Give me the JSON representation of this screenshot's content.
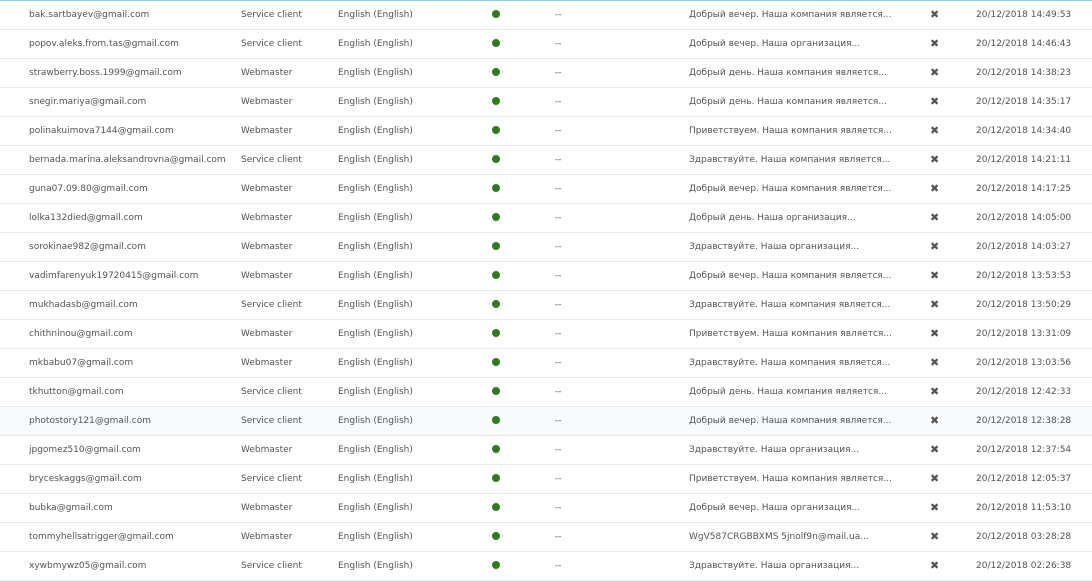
{
  "colors": {
    "status_online": "#2f7a1f",
    "row_border": "#e7eaec",
    "top_border": "#8fd0e6"
  },
  "icons": {
    "status": "status-dot-icon",
    "delete": "close-icon"
  },
  "rows": [
    {
      "email": "bak.sartbayev@gmail.com",
      "role": "Service client",
      "language": "English (English)",
      "dash": "--",
      "message": "Добрый вечер. Наша компания является...",
      "date": "20/12/2018 14:49:53"
    },
    {
      "email": "popov.aleks.from.tas@gmail.com",
      "role": "Service client",
      "language": "English (English)",
      "dash": "--",
      "message": "Добрый вечер. Наша организация...",
      "date": "20/12/2018 14:46:43"
    },
    {
      "email": "strawberry.boss.1999@gmail.com",
      "role": "Webmaster",
      "language": "English (English)",
      "dash": "--",
      "message": "Добрый день. Наша компания является...",
      "date": "20/12/2018 14:38:23"
    },
    {
      "email": "snegir.mariya@gmail.com",
      "role": "Webmaster",
      "language": "English (English)",
      "dash": "--",
      "message": "Добрый день. Наша компания является...",
      "date": "20/12/2018 14:35:17"
    },
    {
      "email": "polinakuimova7144@gmail.com",
      "role": "Webmaster",
      "language": "English (English)",
      "dash": "--",
      "message": "Приветствуем. Наша компания является...",
      "date": "20/12/2018 14:34:40"
    },
    {
      "email": "bernada.marina.aleksandrovna@gmail.com",
      "role": "Service client",
      "language": "English (English)",
      "dash": "--",
      "message": "Здравствуйте. Наша компания является...",
      "date": "20/12/2018 14:21:11"
    },
    {
      "email": "guna07.09.80@gmail.com",
      "role": "Webmaster",
      "language": "English (English)",
      "dash": "--",
      "message": "Добрый вечер. Наша компания является...",
      "date": "20/12/2018 14:17:25"
    },
    {
      "email": "lolka132died@gmail.com",
      "role": "Webmaster",
      "language": "English (English)",
      "dash": "--",
      "message": "Добрый день. Наша организация...",
      "date": "20/12/2018 14:05:00"
    },
    {
      "email": "sorokinae982@gmail.com",
      "role": "Webmaster",
      "language": "English (English)",
      "dash": "--",
      "message": "Здравствуйте. Наша организация...",
      "date": "20/12/2018 14:03:27"
    },
    {
      "email": "vadimfarenyuk19720415@gmail.com",
      "role": "Webmaster",
      "language": "English (English)",
      "dash": "--",
      "message": "Добрый вечер. Наша компания является...",
      "date": "20/12/2018 13:53:53"
    },
    {
      "email": "mukhadasb@gmail.com",
      "role": "Service client",
      "language": "English (English)",
      "dash": "--",
      "message": "Здравствуйте. Наша компания является...",
      "date": "20/12/2018 13:50:29"
    },
    {
      "email": "chithninou@gmail.com",
      "role": "Webmaster",
      "language": "English (English)",
      "dash": "--",
      "message": "Приветствуем. Наша компания является...",
      "date": "20/12/2018 13:31:09"
    },
    {
      "email": "mkbabu07@gmail.com",
      "role": "Webmaster",
      "language": "English (English)",
      "dash": "--",
      "message": "Здравствуйте. Наша компания является...",
      "date": "20/12/2018 13:03:56"
    },
    {
      "email": "tkhutton@gmail.com",
      "role": "Service client",
      "language": "English (English)",
      "dash": "--",
      "message": "Добрый день. Наша компания является...",
      "date": "20/12/2018 12:42:33"
    },
    {
      "email": "photostory121@gmail.com",
      "role": "Service client",
      "language": "English (English)",
      "dash": "--",
      "message": "Добрый вечер. Наша компания является...",
      "date": "20/12/2018 12:38:28"
    },
    {
      "email": "jpgomez510@gmail.com",
      "role": "Webmaster",
      "language": "English (English)",
      "dash": "--",
      "message": "Здравствуйте. Наша организация...",
      "date": "20/12/2018 12:37:54"
    },
    {
      "email": "bryceskaggs@gmail.com",
      "role": "Service client",
      "language": "English (English)",
      "dash": "--",
      "message": "Приветствуем. Наша компания является...",
      "date": "20/12/2018 12:05:37"
    },
    {
      "email": "bubka@gmail.com",
      "role": "Webmaster",
      "language": "English (English)",
      "dash": "--",
      "message": "Добрый вечер. Наша организация...",
      "date": "20/12/2018 11:53:10"
    },
    {
      "email": "tommyhellsatrigger@gmail.com",
      "role": "Webmaster",
      "language": "English (English)",
      "dash": "--",
      "message": "WgV587CRGBBXMS 5jnolf9n@mail.ua...",
      "date": "20/12/2018 03:28:28"
    },
    {
      "email": "xywbmywz05@gmail.com",
      "role": "Service client",
      "language": "English (English)",
      "dash": "--",
      "message": "Здравствуйте. Наша организация...",
      "date": "20/12/2018 02:26:38"
    }
  ]
}
